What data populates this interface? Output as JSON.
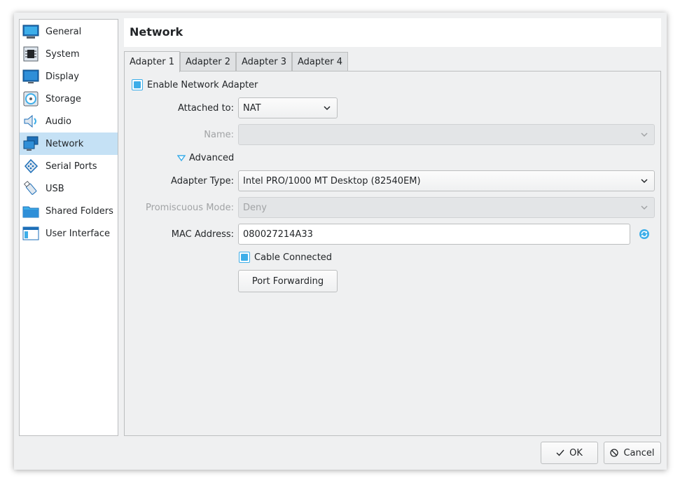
{
  "sidebar": {
    "items": [
      {
        "label": "General",
        "icon": "general-icon"
      },
      {
        "label": "System",
        "icon": "system-icon"
      },
      {
        "label": "Display",
        "icon": "display-icon"
      },
      {
        "label": "Storage",
        "icon": "storage-icon"
      },
      {
        "label": "Audio",
        "icon": "audio-icon"
      },
      {
        "label": "Network",
        "icon": "network-icon",
        "active": true
      },
      {
        "label": "Serial Ports",
        "icon": "serial-ports-icon"
      },
      {
        "label": "USB",
        "icon": "usb-icon"
      },
      {
        "label": "Shared Folders",
        "icon": "shared-folders-icon"
      },
      {
        "label": "User Interface",
        "icon": "user-interface-icon"
      }
    ]
  },
  "page": {
    "title": "Network"
  },
  "tabs": [
    {
      "label": "Adapter 1",
      "active": true
    },
    {
      "label": "Adapter 2"
    },
    {
      "label": "Adapter 3"
    },
    {
      "label": "Adapter 4"
    }
  ],
  "adapter": {
    "enable_label": "Enable Network Adapter",
    "enable_checked": true,
    "attached_label": "Attached to:",
    "attached_value": "NAT",
    "name_label": "Name:",
    "name_value": "",
    "advanced_label": "Advanced",
    "adapter_type_label": "Adapter Type:",
    "adapter_type_value": "Intel PRO/1000 MT Desktop (82540EM)",
    "promiscuous_label": "Promiscuous Mode:",
    "promiscuous_value": "Deny",
    "mac_label": "MAC Address:",
    "mac_value": "080027214A33",
    "cable_label": "Cable Connected",
    "cable_checked": true,
    "port_forwarding_label": "Port Forwarding"
  },
  "footer": {
    "ok_label": "OK",
    "cancel_label": "Cancel"
  },
  "colors": {
    "accent": "#3daee9",
    "selection": "#c5e1f5",
    "window_bg": "#eff0f1"
  }
}
